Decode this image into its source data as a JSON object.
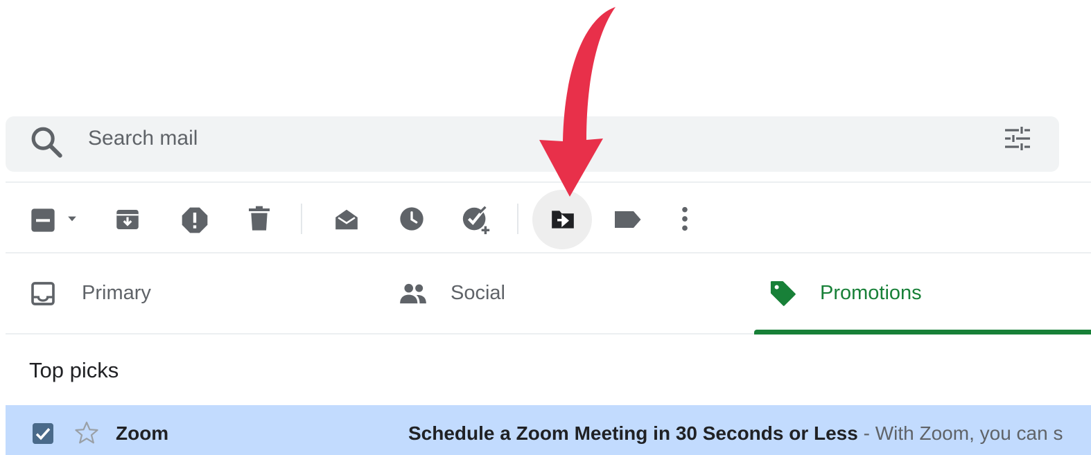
{
  "search": {
    "placeholder": "Search mail",
    "icons": {
      "search": "search-icon",
      "options": "tune-icon"
    }
  },
  "toolbar": {
    "buttons": [
      {
        "name": "select-checkbox",
        "icon": "checkbox-indeterminate-icon"
      },
      {
        "name": "select-menu",
        "icon": "caret-down-icon"
      },
      {
        "name": "archive",
        "icon": "archive-icon"
      },
      {
        "name": "report-spam",
        "icon": "report-icon"
      },
      {
        "name": "delete",
        "icon": "trash-icon"
      },
      {
        "name": "mark-as-read",
        "icon": "open-envelope-icon"
      },
      {
        "name": "snooze",
        "icon": "clock-icon"
      },
      {
        "name": "add-to-tasks",
        "icon": "add-task-icon"
      },
      {
        "name": "move-to",
        "icon": "folder-move-icon",
        "highlighted": true
      },
      {
        "name": "labels",
        "icon": "label-icon"
      },
      {
        "name": "more",
        "icon": "more-vert-icon"
      }
    ]
  },
  "tabs": [
    {
      "label": "Primary",
      "icon": "inbox-icon",
      "active": false
    },
    {
      "label": "Social",
      "icon": "people-icon",
      "active": false
    },
    {
      "label": "Promotions",
      "icon": "tag-icon",
      "active": true
    }
  ],
  "section": {
    "title": "Top picks"
  },
  "emails": [
    {
      "sender": "Zoom",
      "subject": "Schedule a Zoom Meeting in 30 Seconds or Less",
      "snippet": " - With Zoom, you can s",
      "selected": true,
      "starred": false
    }
  ],
  "colors": {
    "search_bg": "#f1f3f4",
    "icon_gray": "#5f6368",
    "promotions_green": "#188038",
    "selected_row": "#c2dbfe",
    "checkbox_blue": "#4a6a8a",
    "annotation_red": "#e8304a"
  }
}
